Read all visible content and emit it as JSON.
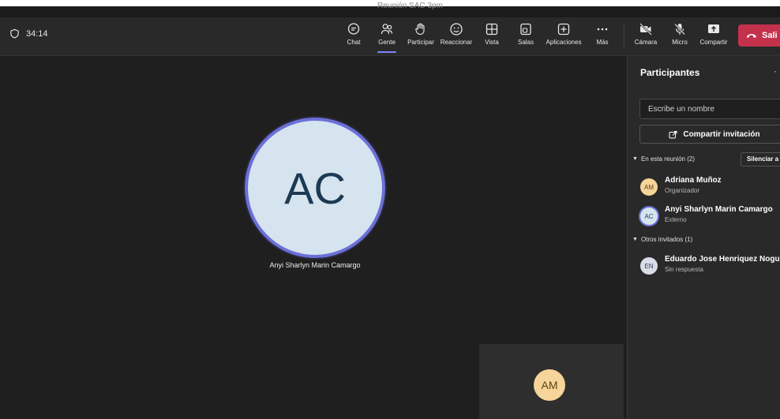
{
  "window": {
    "title": "Reunión SAC 3pm"
  },
  "toolbar": {
    "timer": "34:14",
    "buttons": [
      {
        "label": "Chat",
        "icon": "chat-icon"
      },
      {
        "label": "Gente",
        "icon": "people-icon"
      },
      {
        "label": "Participar",
        "icon": "raise-hand-icon"
      },
      {
        "label": "Reaccionar",
        "icon": "smiley-icon"
      },
      {
        "label": "Vista",
        "icon": "grid-view-icon"
      },
      {
        "label": "Salas",
        "icon": "breakout-rooms-icon"
      },
      {
        "label": "Aplicaciones",
        "icon": "add-apps-icon"
      },
      {
        "label": "Más",
        "icon": "more-icon"
      },
      {
        "label": "Cámara",
        "icon": "camera-off-icon"
      },
      {
        "label": "Micro",
        "icon": "mic-off-icon"
      },
      {
        "label": "Compartir",
        "icon": "share-screen-icon"
      }
    ],
    "leave_label": "Sali",
    "accent": "#7f85f5",
    "leave_color": "#c4314b"
  },
  "stage": {
    "main_initials": "AC",
    "main_name": "Anyi Sharlyn Marin Camargo",
    "self_initials": "AM"
  },
  "panel": {
    "title": "Participantes",
    "more": "·",
    "search_placeholder": "Escribe un nombre",
    "share_invite_label": "Compartir invitación",
    "in_meeting_label": "En esta reunión (2)",
    "mute_all_label": "Silenciar a",
    "in_meeting": [
      {
        "initials": "AM",
        "name": "Adriana Muñoz",
        "role": "Organizador"
      },
      {
        "initials": "AC",
        "name": "Anyi Sharlyn Marin Camargo",
        "role": "Externo"
      }
    ],
    "others_label": "Otros invitados (1)",
    "others": [
      {
        "initials": "EN",
        "name": "Eduardo Jose Henriquez Nogu",
        "role": "Sin respuesta"
      }
    ]
  }
}
